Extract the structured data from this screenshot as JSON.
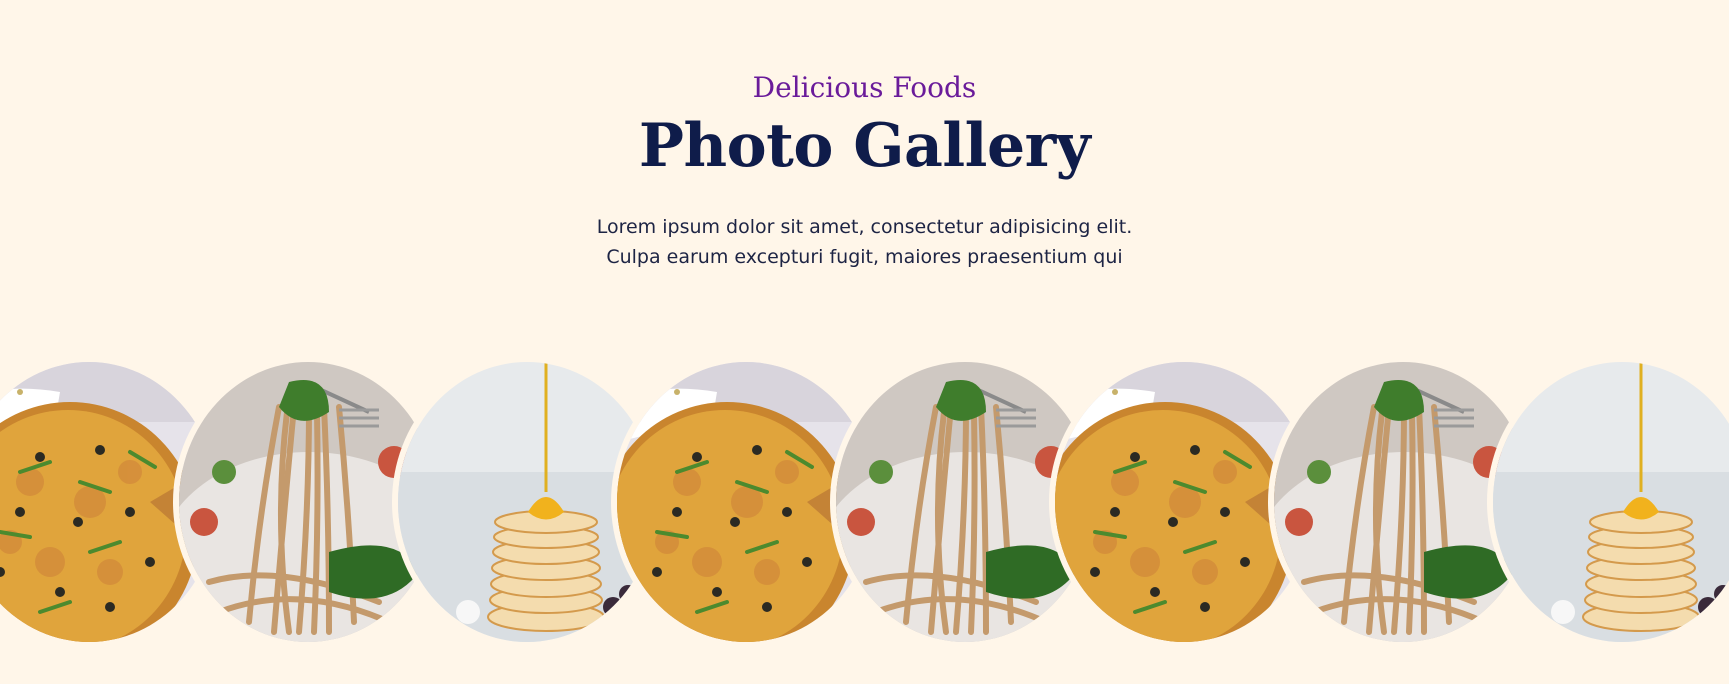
{
  "section": {
    "subtitle": "Delicious Foods",
    "title": "Photo Gallery",
    "description_lines": [
      "Lorem ipsum dolor sit amet, consectetur adipisicing elit.",
      "Culpa earum excepturi fugit, maiores praesentium qui"
    ]
  },
  "colors": {
    "background": "#fff6e9",
    "subtitle": "#6a1b9a",
    "title": "#0f1c4a",
    "text": "#1d2444"
  },
  "gallery": {
    "items": [
      {
        "name": "pizza-photo"
      },
      {
        "name": "spaghetti-photo"
      },
      {
        "name": "pancakes-photo"
      },
      {
        "name": "pizza-photo"
      },
      {
        "name": "spaghetti-photo"
      },
      {
        "name": "pizza-photo"
      },
      {
        "name": "spaghetti-photo"
      },
      {
        "name": "pancakes-photo"
      }
    ]
  }
}
